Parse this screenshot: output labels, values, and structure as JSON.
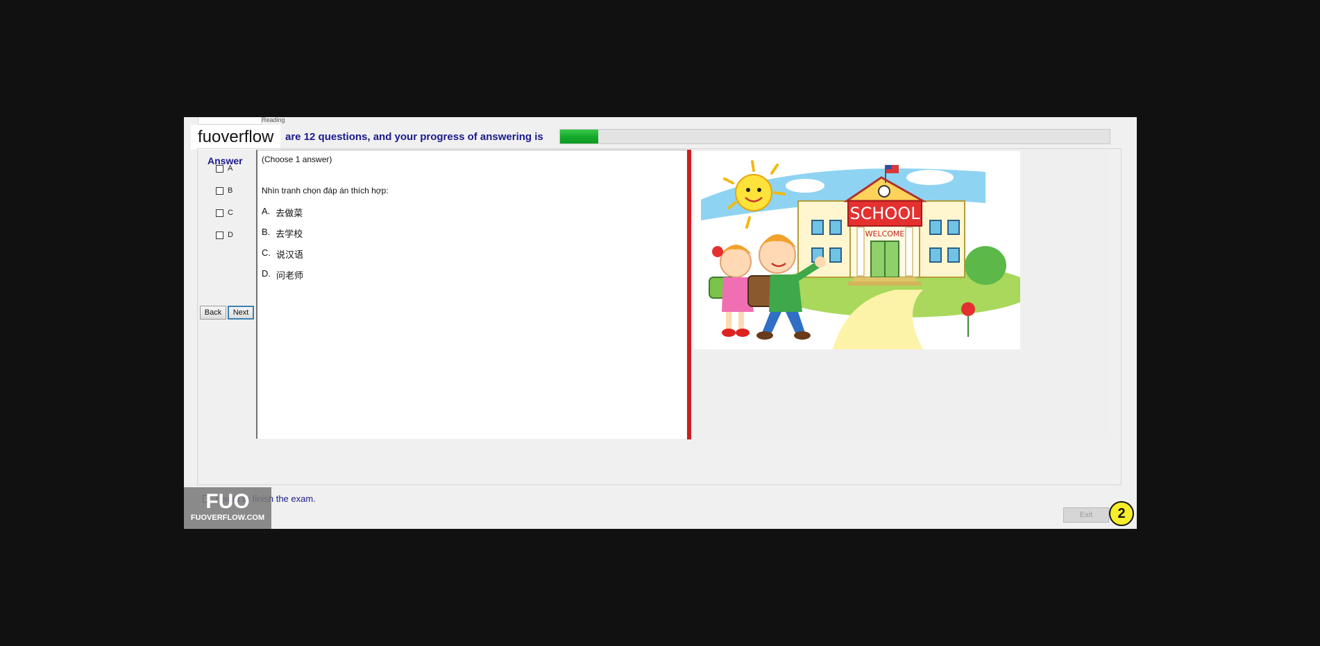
{
  "top_tab_text": "Reading",
  "watermark_text": "fuoverflow",
  "progress": {
    "label": "are 12 questions, and your progress of answering is",
    "fraction": 0.07,
    "fill_color": "#1db233"
  },
  "answer": {
    "title": "Answer",
    "options": [
      "A",
      "B",
      "C",
      "D"
    ]
  },
  "nav": {
    "back": "Back",
    "next": "Next"
  },
  "question": {
    "instruction": "(Choose 1 answer)",
    "prompt": "Nhìn tranh chọn đáp án thích hợp:",
    "choices": [
      {
        "letter": "A.",
        "text": "去做菜"
      },
      {
        "letter": "B.",
        "text": "去学校"
      },
      {
        "letter": "C.",
        "text": "说汉语"
      },
      {
        "letter": "D.",
        "text": "问老师"
      }
    ]
  },
  "image": {
    "school_sign": "SCHOOL",
    "welcome_sign": "WELCOME"
  },
  "finish_label": "I want to finish the exam.",
  "fuo_badge": {
    "big": "FUO",
    "small": "FUOVERFLOW.COM"
  },
  "exit_label": "Exit",
  "page_badge": "2",
  "colors": {
    "splitter": "#cc1f1f",
    "heading": "#1a1a8c",
    "badge": "#f6ee2a"
  }
}
